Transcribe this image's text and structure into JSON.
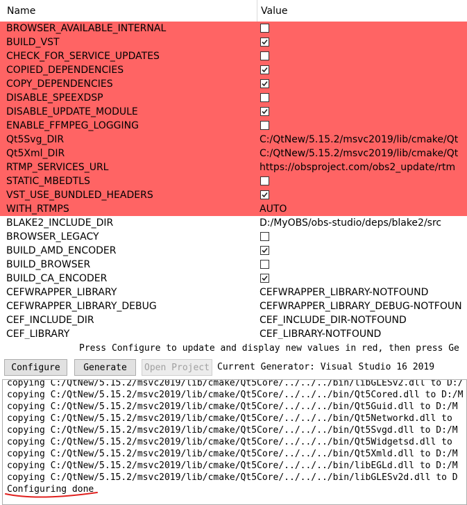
{
  "header": {
    "name": "Name",
    "value": "Value"
  },
  "rows": [
    {
      "name": "BROWSER_AVAILABLE_INTERNAL",
      "type": "bool",
      "checked": false,
      "new": true
    },
    {
      "name": "BUILD_VST",
      "type": "bool",
      "checked": true,
      "new": true
    },
    {
      "name": "CHECK_FOR_SERVICE_UPDATES",
      "type": "bool",
      "checked": false,
      "new": true
    },
    {
      "name": "COPIED_DEPENDENCIES",
      "type": "bool",
      "checked": true,
      "new": true
    },
    {
      "name": "COPY_DEPENDENCIES",
      "type": "bool",
      "checked": true,
      "new": true
    },
    {
      "name": "DISABLE_SPEEXDSP",
      "type": "bool",
      "checked": false,
      "new": true
    },
    {
      "name": "DISABLE_UPDATE_MODULE",
      "type": "bool",
      "checked": true,
      "new": true
    },
    {
      "name": "ENABLE_FFMPEG_LOGGING",
      "type": "bool",
      "checked": false,
      "new": true
    },
    {
      "name": "Qt5Svg_DIR",
      "type": "text",
      "value": "C:/QtNew/5.15.2/msvc2019/lib/cmake/Qt",
      "new": true
    },
    {
      "name": "Qt5Xml_DIR",
      "type": "text",
      "value": "C:/QtNew/5.15.2/msvc2019/lib/cmake/Qt",
      "new": true
    },
    {
      "name": "RTMP_SERVICES_URL",
      "type": "text",
      "value": "https://obsproject.com/obs2_update/rtm",
      "new": true
    },
    {
      "name": "STATIC_MBEDTLS",
      "type": "bool",
      "checked": false,
      "new": true
    },
    {
      "name": "VST_USE_BUNDLED_HEADERS",
      "type": "bool",
      "checked": true,
      "new": true
    },
    {
      "name": "WITH_RTMPS",
      "type": "text",
      "value": "AUTO",
      "new": true
    },
    {
      "name": "BLAKE2_INCLUDE_DIR",
      "type": "text",
      "value": "D:/MyOBS/obs-studio/deps/blake2/src",
      "new": false
    },
    {
      "name": "BROWSER_LEGACY",
      "type": "bool",
      "checked": false,
      "new": false
    },
    {
      "name": "BUILD_AMD_ENCODER",
      "type": "bool",
      "checked": true,
      "new": false
    },
    {
      "name": "BUILD_BROWSER",
      "type": "bool",
      "checked": false,
      "new": false
    },
    {
      "name": "BUILD_CA_ENCODER",
      "type": "bool",
      "checked": true,
      "new": false
    },
    {
      "name": "CEFWRAPPER_LIBRARY",
      "type": "text",
      "value": "CEFWRAPPER_LIBRARY-NOTFOUND",
      "new": false
    },
    {
      "name": "CEFWRAPPER_LIBRARY_DEBUG",
      "type": "text",
      "value": "CEFWRAPPER_LIBRARY_DEBUG-NOTFOUN",
      "new": false
    },
    {
      "name": "CEF_INCLUDE_DIR",
      "type": "text",
      "value": "CEF_INCLUDE_DIR-NOTFOUND",
      "new": false
    },
    {
      "name": "CEF_LIBRARY",
      "type": "text",
      "value": "CEF_LIBRARY-NOTFOUND",
      "new": false
    }
  ],
  "hint": "Press Configure to update and display new values in red, then press Ge",
  "toolbar": {
    "configure_label": "Configure",
    "generate_label": "Generate",
    "open_project_label": "Open Project",
    "generator_text": "Current Generator: Visual Studio 16 2019"
  },
  "log": [
    "copying C:/QtNew/5.15.2/msvc2019/lib/cmake/Qt5Core/../../../bin/libGLESv2.dll to D:/",
    "copying C:/QtNew/5.15.2/msvc2019/lib/cmake/Qt5Core/../../../bin/Qt5Cored.dll to D:/M",
    "copying C:/QtNew/5.15.2/msvc2019/lib/cmake/Qt5Core/../../../bin/Qt5Guid.dll to D:/M",
    "copying C:/QtNew/5.15.2/msvc2019/lib/cmake/Qt5Core/../../../bin/Qt5Networkd.dll to",
    "copying C:/QtNew/5.15.2/msvc2019/lib/cmake/Qt5Core/../../../bin/Qt5Svgd.dll to D:/M",
    "copying C:/QtNew/5.15.2/msvc2019/lib/cmake/Qt5Core/../../../bin/Qt5Widgetsd.dll to",
    "copying C:/QtNew/5.15.2/msvc2019/lib/cmake/Qt5Core/../../../bin/Qt5Xmld.dll to D:/M",
    "copying C:/QtNew/5.15.2/msvc2019/lib/cmake/Qt5Core/../../../bin/libEGLd.dll to D:/M",
    "copying C:/QtNew/5.15.2/msvc2019/lib/cmake/Qt5Core/../../../bin/libGLESv2d.dll to D",
    "Configuring done"
  ],
  "colors": {
    "new_row": "#ff6464",
    "annotation": "#e0201e"
  },
  "icons": {
    "checkbox": "checkbox-icon",
    "checkmark": "checkmark-icon"
  }
}
